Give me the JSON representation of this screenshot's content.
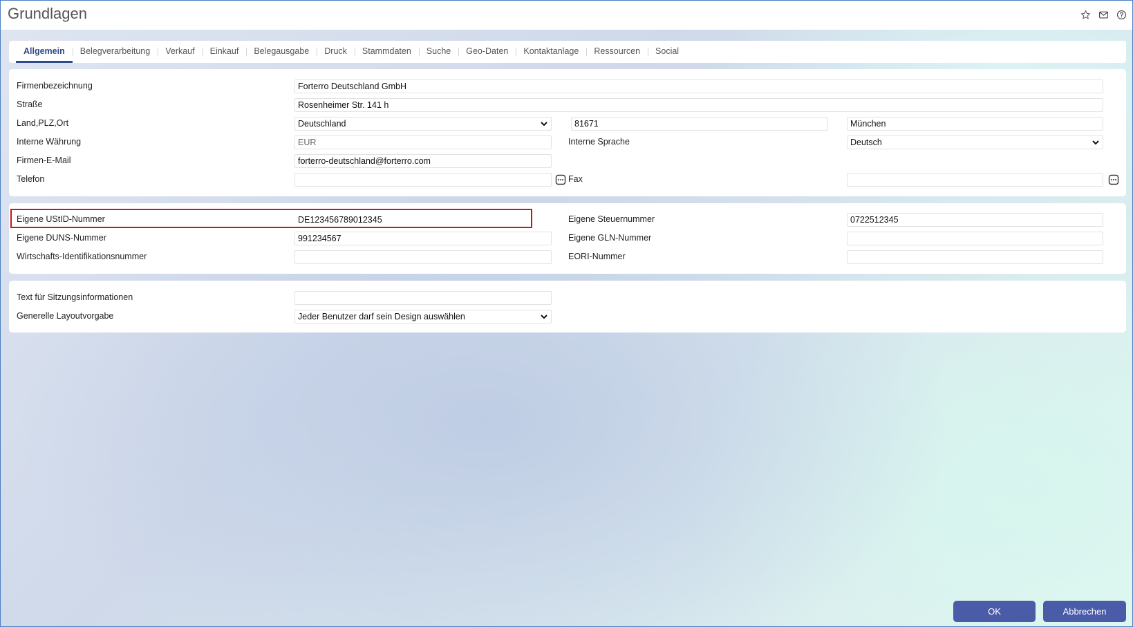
{
  "window": {
    "title": "Grundlagen",
    "icons": [
      "star-icon",
      "mail-icon",
      "help-icon"
    ]
  },
  "tabs": [
    {
      "label": "Allgemein",
      "active": true
    },
    {
      "label": "Belegverarbeitung"
    },
    {
      "label": "Verkauf"
    },
    {
      "label": "Einkauf"
    },
    {
      "label": "Belegausgabe"
    },
    {
      "label": "Druck"
    },
    {
      "label": "Stammdaten"
    },
    {
      "label": "Suche"
    },
    {
      "label": "Geo-Daten"
    },
    {
      "label": "Kontaktanlage"
    },
    {
      "label": "Ressourcen"
    },
    {
      "label": "Social"
    }
  ],
  "company": {
    "name_label": "Firmenbezeichnung",
    "name_value": "Forterro Deutschland GmbH",
    "street_label": "Straße",
    "street_value": "Rosenheimer Str. 141 h",
    "country_label": "Land,PLZ,Ort",
    "country_value": "Deutschland",
    "zip_value": "81671",
    "city_value": "München",
    "currency_label": "Interne Währung",
    "currency_value": "EUR",
    "language_label": "Interne Sprache",
    "language_value": "Deutsch",
    "email_label": "Firmen-E-Mail",
    "email_value": "forterro-deutschland@forterro.com",
    "phone_label": "Telefon",
    "phone_value": "",
    "fax_label": "Fax",
    "fax_value": ""
  },
  "ids": {
    "vat_label": "Eigene UStID-Nummer",
    "vat_value": "DE123456789012345",
    "tax_label": "Eigene Steuernummer",
    "tax_value": "0722512345",
    "duns_label": "Eigene DUNS-Nummer",
    "duns_value": "991234567",
    "gln_label": "Eigene GLN-Nummer",
    "gln_value": "",
    "wid_label": "Wirtschafts-Identifikationsnummer",
    "wid_value": "",
    "eori_label": "EORI-Nummer",
    "eori_value": ""
  },
  "session": {
    "text_label": "Text für Sitzungsinformationen",
    "text_value": "",
    "layout_label": "Generelle Layoutvorgabe",
    "layout_value": "Jeder Benutzer darf sein Design auswählen"
  },
  "footer": {
    "ok_label": "OK",
    "cancel_label": "Abbrechen"
  },
  "colors": {
    "accent": "#2f4a8a",
    "button": "#4a5ca8",
    "highlight": "#d0111b"
  }
}
